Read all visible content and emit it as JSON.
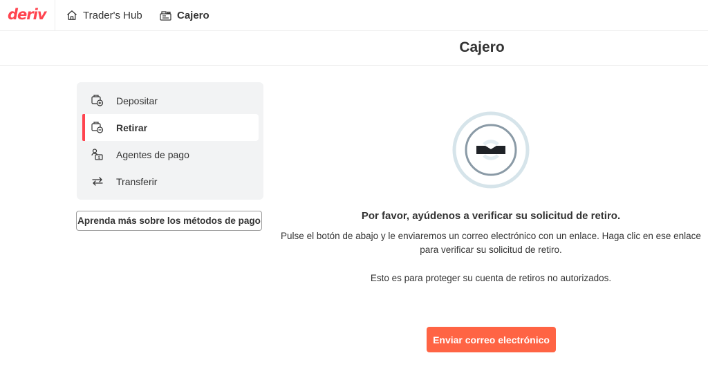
{
  "header": {
    "logo_text": "deriv",
    "nav": [
      {
        "label": "Trader's Hub",
        "icon": "home-icon"
      },
      {
        "label": "Cajero",
        "icon": "cashier-icon"
      }
    ]
  },
  "page": {
    "title": "Cajero"
  },
  "sidebar": {
    "items": [
      {
        "label": "Depositar",
        "icon": "deposit-icon",
        "active": false
      },
      {
        "label": "Retirar",
        "icon": "withdraw-icon",
        "active": true
      },
      {
        "label": "Agentes de pago",
        "icon": "payment-agent-icon",
        "active": false
      },
      {
        "label": "Transferir",
        "icon": "transfer-icon",
        "active": false
      }
    ],
    "learn_more_label": "Aprenda más sobre los métodos de pago"
  },
  "main": {
    "illustration_icon": "email-verification-icon",
    "heading": "Por favor, ayúdenos a verificar su solicitud de retiro.",
    "body_1": "Pulse el botón de abajo y le enviaremos un correo electrónico con un enlace. Haga clic en ese enlace para verificar su solicitud de retiro.",
    "body_2": "Esto es para proteger su cuenta de retiros no autorizados.",
    "button_label": "Enviar correo electrónico"
  },
  "colors": {
    "brand": "#ff444f",
    "button": "#ff6444",
    "sidebar_bg": "#f2f3f4",
    "illustration_ring": "#d6e4ea",
    "illustration_stroke": "#8a9aa6"
  }
}
